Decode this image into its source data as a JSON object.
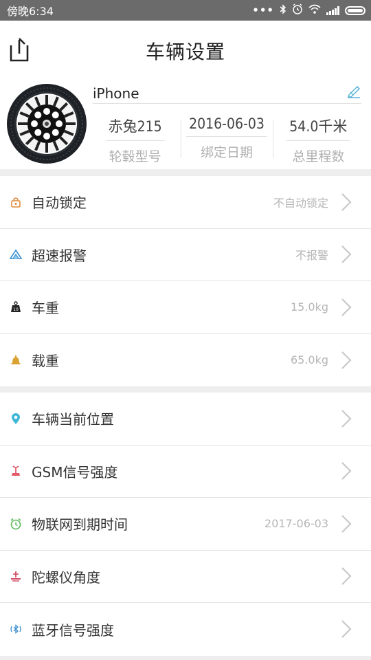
{
  "status_bar": {
    "time": "傍晚6:34",
    "dots": "•••"
  },
  "header": {
    "title": "车辆设置"
  },
  "vehicle": {
    "name": "iPhone",
    "stats": [
      {
        "value": "赤兔215",
        "label": "轮毂型号"
      },
      {
        "value": "2016-06-03",
        "label": "绑定日期"
      },
      {
        "value": "54.0千米",
        "label": "总里程数"
      }
    ]
  },
  "settings_group_1": [
    {
      "label": "自动锁定",
      "value": "不自动锁定",
      "icon": "lock-icon",
      "color": "#e08a3c"
    },
    {
      "label": "超速报警",
      "value": "不报警",
      "icon": "speed-icon",
      "color": "#3a8fd0"
    },
    {
      "label": "车重",
      "value": "15.0kg",
      "icon": "weight-icon",
      "color": "#222222"
    },
    {
      "label": "载重",
      "value": "65.0kg",
      "icon": "bell-icon",
      "color": "#d9a232"
    }
  ],
  "settings_group_2": [
    {
      "label": "车辆当前位置",
      "value": "",
      "icon": "location-pin-icon",
      "color": "#3cb6d6"
    },
    {
      "label": "GSM信号强度",
      "value": "",
      "icon": "signal-tower-icon",
      "color": "#e05a6a"
    },
    {
      "label": "物联网到期时间",
      "value": "2017-06-03",
      "icon": "alarm-clock-icon",
      "color": "#5cb85c"
    },
    {
      "label": "陀螺仪角度",
      "value": "",
      "icon": "gyroscope-icon",
      "color": "#d14b63"
    },
    {
      "label": "蓝牙信号强度",
      "value": "",
      "icon": "bluetooth-icon",
      "color": "#3a8fd0"
    }
  ]
}
